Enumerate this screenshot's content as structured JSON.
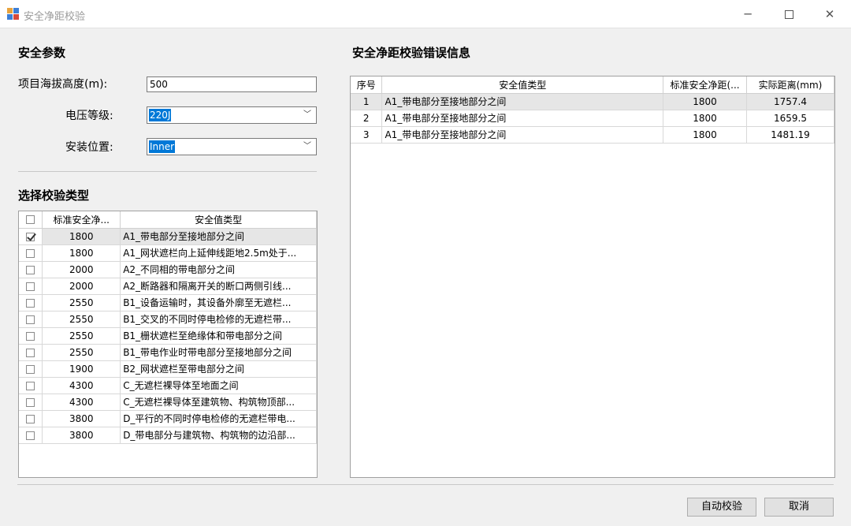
{
  "window": {
    "title": "安全净距校验",
    "controls": {
      "minimize": "─",
      "close": "✕"
    }
  },
  "safety_params": {
    "section_title": "安全参数",
    "altitude": {
      "label": "项目海拔高度(m):",
      "value": "500"
    },
    "voltage": {
      "label": "电压等级:",
      "value": "220J"
    },
    "location": {
      "label": "安装位置:",
      "value": "Inner"
    }
  },
  "check_types": {
    "section_title": "选择校验类型",
    "columns": [
      "",
      "标准安全净...",
      "安全值类型"
    ],
    "rows": [
      {
        "checked": true,
        "value": "1800",
        "type": "A1_带电部分至接地部分之间"
      },
      {
        "checked": false,
        "value": "1800",
        "type": "A1_网状遮栏向上延伸线距地2.5m处于..."
      },
      {
        "checked": false,
        "value": "2000",
        "type": "A2_不同相的带电部分之间"
      },
      {
        "checked": false,
        "value": "2000",
        "type": "A2_断路器和隔离开关的断口两侧引线..."
      },
      {
        "checked": false,
        "value": "2550",
        "type": "B1_设备运输时，其设备外廓至无遮栏..."
      },
      {
        "checked": false,
        "value": "2550",
        "type": "B1_交叉的不同时停电检修的无遮栏带..."
      },
      {
        "checked": false,
        "value": "2550",
        "type": "B1_栅状遮栏至绝缘体和带电部分之间"
      },
      {
        "checked": false,
        "value": "2550",
        "type": "B1_带电作业时带电部分至接地部分之间"
      },
      {
        "checked": false,
        "value": "1900",
        "type": "B2_网状遮栏至带电部分之间"
      },
      {
        "checked": false,
        "value": "4300",
        "type": "C_无遮栏裸导体至地面之间"
      },
      {
        "checked": false,
        "value": "4300",
        "type": "C_无遮栏裸导体至建筑物、构筑物顶部..."
      },
      {
        "checked": false,
        "value": "3800",
        "type": "D_平行的不同时停电检修的无遮栏带电..."
      },
      {
        "checked": false,
        "value": "3800",
        "type": "D_带电部分与建筑物、构筑物的边沿部..."
      }
    ]
  },
  "errors": {
    "section_title": "安全净距校验错误信息",
    "columns": [
      "序号",
      "安全值类型",
      "标准安全净距(...",
      "实际距离(mm)"
    ],
    "rows": [
      {
        "index": "1",
        "type": "A1_带电部分至接地部分之间",
        "standard": "1800",
        "actual": "1757.4"
      },
      {
        "index": "2",
        "type": "A1_带电部分至接地部分之间",
        "standard": "1800",
        "actual": "1659.5"
      },
      {
        "index": "3",
        "type": "A1_带电部分至接地部分之间",
        "standard": "1800",
        "actual": "1481.19"
      }
    ]
  },
  "buttons": {
    "check": "自动校验",
    "cancel": "取消"
  }
}
